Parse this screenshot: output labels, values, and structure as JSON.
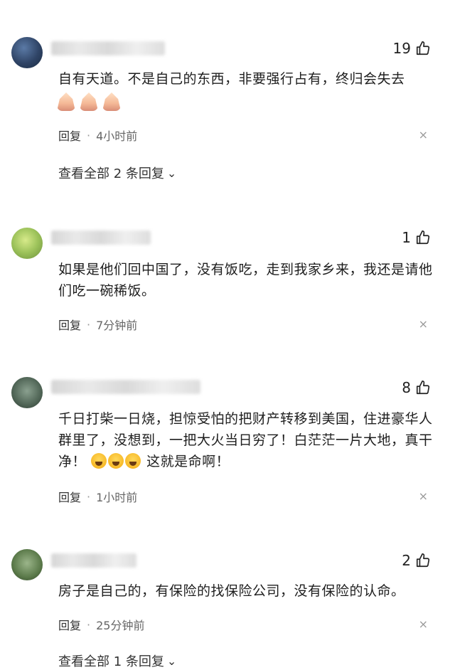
{
  "comments": [
    {
      "likes": "19",
      "text": "自有天道。不是自己的东西，非要强行占有，终归会失去",
      "reply_label": "回复",
      "separator": "·",
      "time": "4小时前",
      "view_all": "查看全部 2 条回复"
    },
    {
      "likes": "1",
      "text": "如果是他们回中国了，没有饭吃，走到我家乡来，我还是请他们吃一碗稀饭。",
      "reply_label": "回复",
      "separator": "·",
      "time": "7分钟前"
    },
    {
      "likes": "8",
      "text_part1": "千日打柴一日烧，担惊受怕的把财产转移到美国，住进豪华人群里了，没想到，一把大火当日穷了！白茫茫一片大地，真干净！",
      "text_part2": "这就是命啊！",
      "reply_label": "回复",
      "separator": "·",
      "time": "1小时前"
    },
    {
      "likes": "2",
      "text": "房子是自己的，有保险的找保险公司，没有保险的认命。",
      "reply_label": "回复",
      "separator": "·",
      "time": "25分钟前",
      "view_all": "查看全部 1 条回复"
    }
  ],
  "icons": {
    "like": "thumbs-up-icon",
    "close": "close-icon",
    "chevron": "chevron-down-icon",
    "pray": "folded-hands-emoji",
    "cry": "crying-face-emoji"
  },
  "glyphs": {
    "close": "×",
    "chevron": "⌄"
  }
}
